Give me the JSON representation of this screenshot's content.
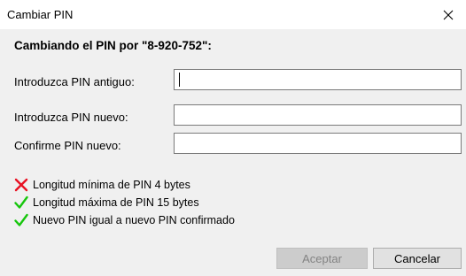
{
  "window": {
    "title": "Cambiar PIN",
    "close_icon": "close-icon"
  },
  "heading": "Cambiando el PIN por \"8-920-752\":",
  "fields": {
    "old_pin": {
      "label": "Introduzca PIN antiguo:",
      "value": ""
    },
    "new_pin": {
      "label": "Introduzca PIN nuevo:",
      "value": ""
    },
    "confirm_pin": {
      "label": "Confirme PIN nuevo:",
      "value": ""
    }
  },
  "rules": [
    {
      "text": "Longitud mínima de PIN 4 bytes",
      "status": "fail",
      "icon": "cross-icon",
      "color": "#e81123"
    },
    {
      "text": "Longitud máxima de PIN 15 bytes",
      "status": "pass",
      "icon": "check-icon",
      "color": "#16c60c"
    },
    {
      "text": "Nuevo PIN igual a nuevo PIN confirmado",
      "status": "pass",
      "icon": "check-icon",
      "color": "#16c60c"
    }
  ],
  "buttons": {
    "accept": {
      "label": "Aceptar",
      "enabled": false
    },
    "cancel": {
      "label": "Cancelar",
      "enabled": true
    }
  }
}
